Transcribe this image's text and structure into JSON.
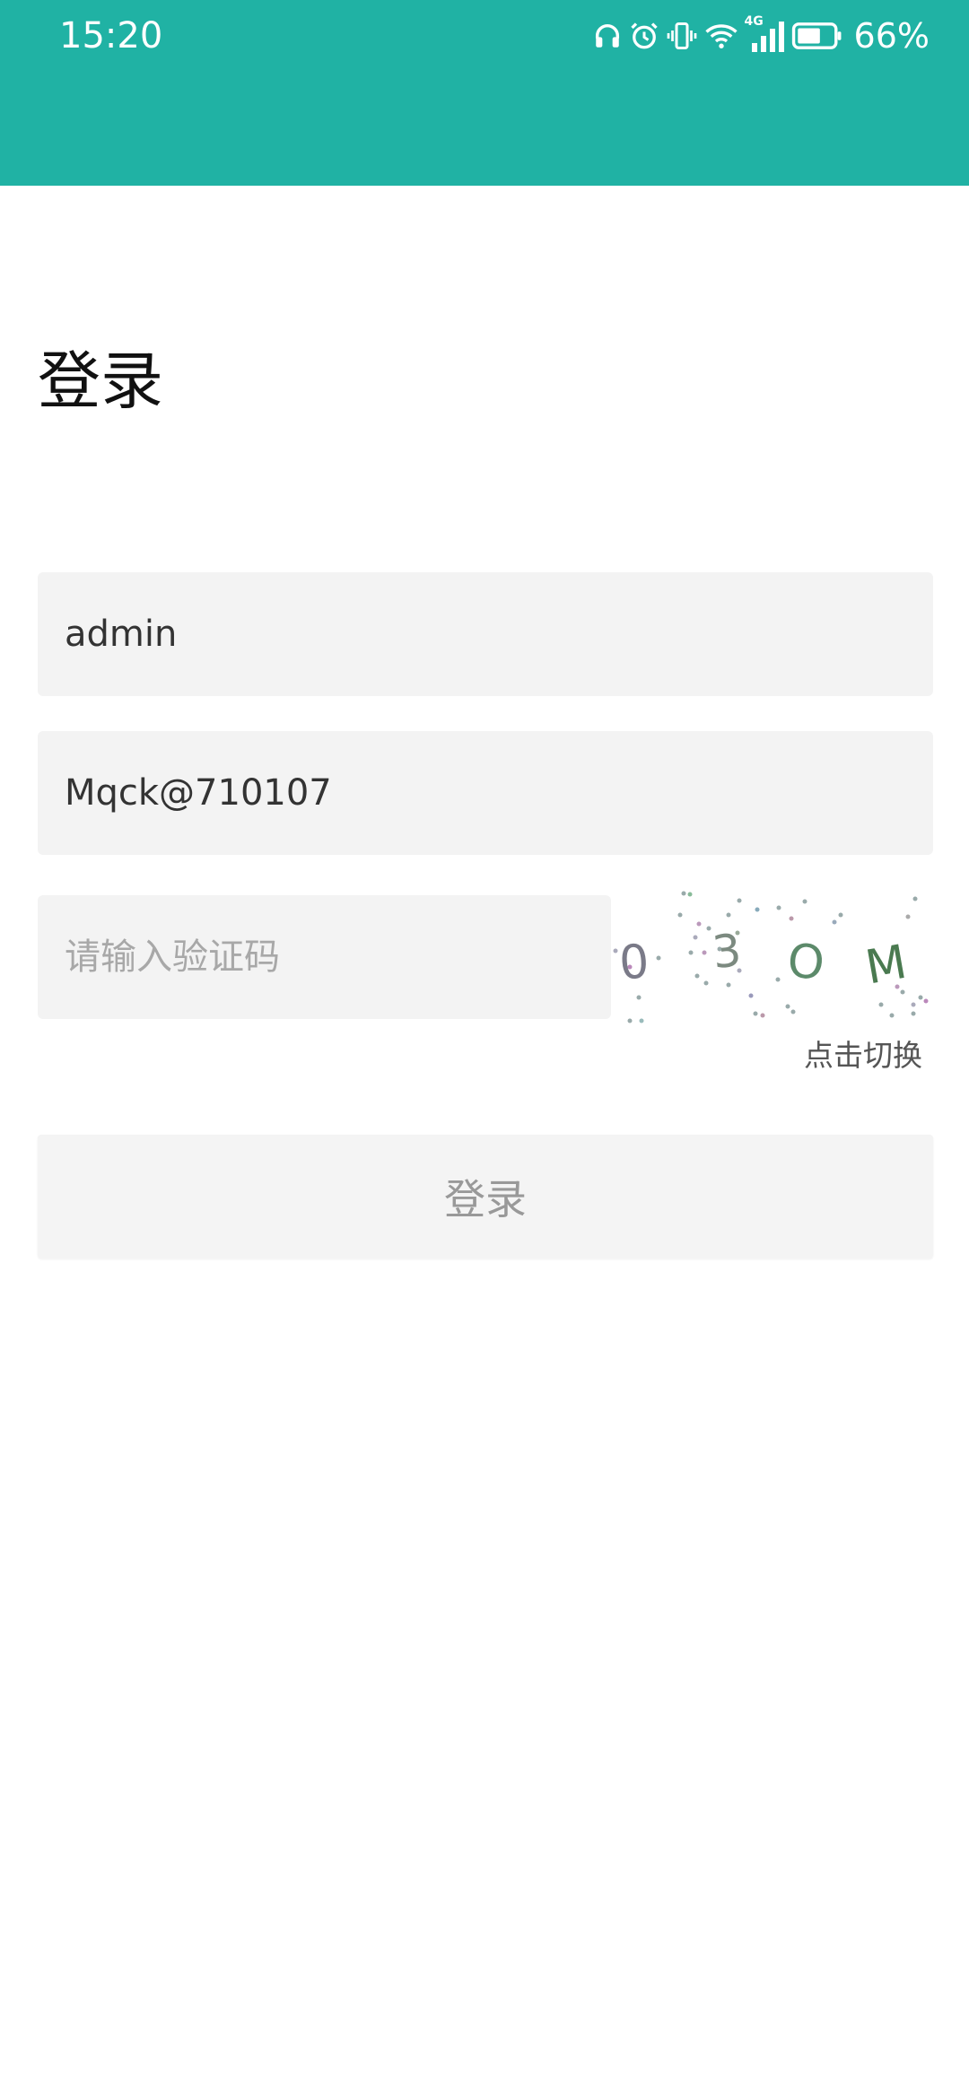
{
  "status_bar": {
    "time": "15:20",
    "network": "4G",
    "battery_percent": "66%",
    "icons": [
      "headphones-icon",
      "alarm-icon",
      "vibrate-icon",
      "wifi-icon",
      "signal-icon",
      "battery-icon"
    ]
  },
  "colors": {
    "header": "#20b2a4",
    "field_bg": "#f3f3f3",
    "button_bg": "#f4f4f4",
    "button_text": "#999999"
  },
  "login": {
    "title": "登录",
    "username_value": "admin",
    "password_value": "Mqck@710107",
    "captcha_placeholder": "请输入验证码",
    "captcha_code": [
      "0",
      "3",
      "O",
      "M"
    ],
    "captcha_switch_label": "点击切换",
    "submit_label": "登录"
  }
}
